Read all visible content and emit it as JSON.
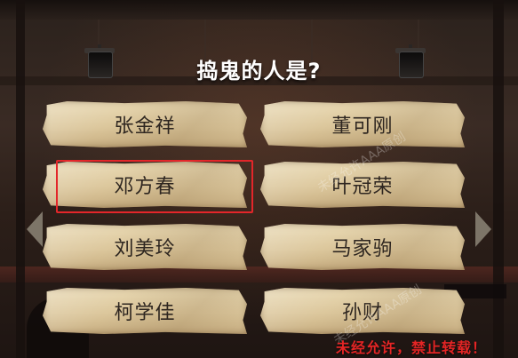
{
  "question": "捣鬼的人是?",
  "options": [
    {
      "label": "张金祥"
    },
    {
      "label": "董可刚"
    },
    {
      "label": "邓方春",
      "selected": true
    },
    {
      "label": "叶冠荣"
    },
    {
      "label": "刘美玲"
    },
    {
      "label": "马家驹"
    },
    {
      "label": "柯学佳"
    },
    {
      "label": "孙财"
    }
  ],
  "watermark": "未经允许AAA原创",
  "notice": "未经允许，禁止转载！",
  "colors": {
    "highlight": "#e3262a",
    "card": "#dcc79c",
    "notice": "#e42525"
  },
  "icons": [
    "left-arrow-icon",
    "right-arrow-icon",
    "stage-lamp-icon"
  ]
}
